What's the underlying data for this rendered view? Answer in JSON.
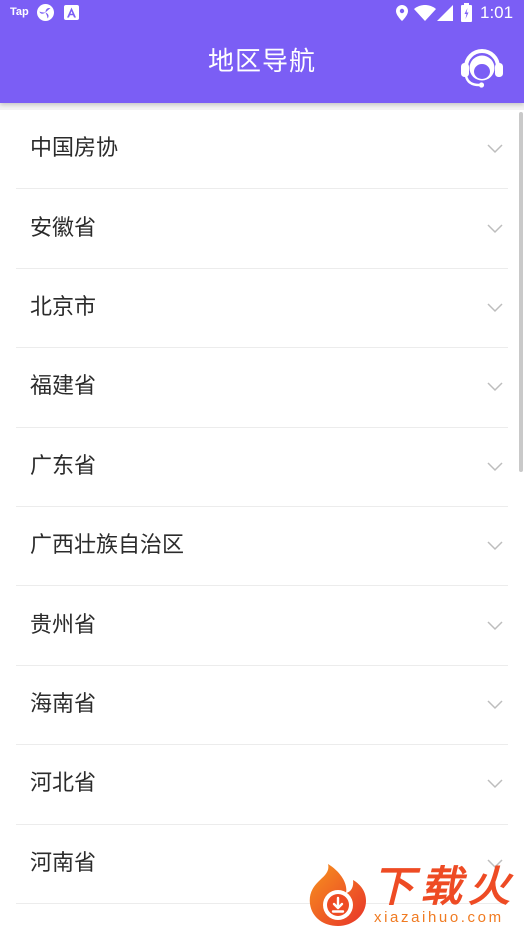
{
  "status_bar": {
    "notification_label": "Tap",
    "time": "1:01",
    "left_icons": [
      "swirl-app-icon",
      "a-app-icon"
    ],
    "right_icons": [
      "location-icon",
      "wifi-icon",
      "cell-signal-icon",
      "battery-icon"
    ]
  },
  "header": {
    "title": "地区导航",
    "action_icon": "customer-service-headset-icon"
  },
  "region_list": {
    "item_icon": "chevron-down-icon",
    "items": [
      {
        "label": "中国房协"
      },
      {
        "label": "安徽省"
      },
      {
        "label": "北京市"
      },
      {
        "label": "福建省"
      },
      {
        "label": "广东省"
      },
      {
        "label": "广西壮族自治区"
      },
      {
        "label": "贵州省"
      },
      {
        "label": "海南省"
      },
      {
        "label": "河北省"
      },
      {
        "label": "河南省"
      }
    ]
  },
  "watermark": {
    "brand": "下载火",
    "domain": "xiazaihuo.com",
    "logo_icon": "flame-download-icon"
  },
  "colors": {
    "primary": "#7B5EF5",
    "on_primary": "#FFFFFF",
    "list_text": "#2B2B2B",
    "divider": "#ECECEC",
    "chevron": "#BDBDBD",
    "watermark_red": "#EE4B24",
    "watermark_orange": "#F07B22"
  }
}
